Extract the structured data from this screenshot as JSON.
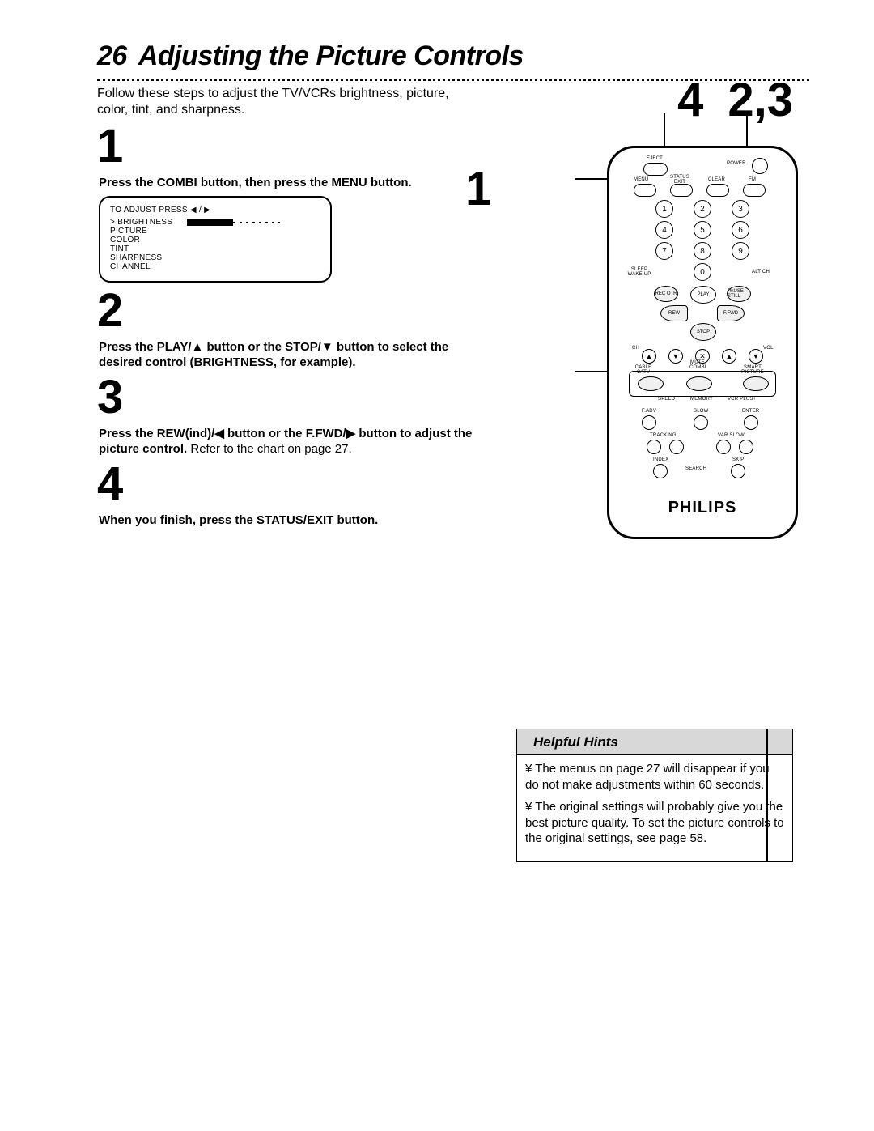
{
  "page_number": "26",
  "title": "Adjusting the Picture Controls",
  "intro": "Follow these steps to adjust the TV/VCRs brightness, picture, color, tint, and sharpness.",
  "callouts": {
    "c4": "4",
    "c23": "2,3",
    "c1": "1"
  },
  "steps": {
    "s1": {
      "num": "1",
      "text": "Press the COMBI button, then press the MENU button."
    },
    "s2": {
      "num": "2",
      "text": "Press the PLAY/▲ button or the STOP/▼ button to select the desired control (BRIGHTNESS, for example)."
    },
    "s3": {
      "num": "3",
      "text_a": "Press the REW(ind)/◀ button or the F.FWD/▶ button to adjust the picture control.",
      "text_b": "Refer to the chart on page 27."
    },
    "s4": {
      "num": "4",
      "text": "When you finish, press the STATUS/EXIT button."
    }
  },
  "osd": {
    "title": "TO ADJUST PRESS  ◀ / ▶",
    "items": [
      "> BRIGHTNESS",
      "  PICTURE",
      "  COLOR",
      "  TINT",
      "  SHARPNESS",
      "  CHANNEL"
    ]
  },
  "remote": {
    "top_row": [
      "EJECT",
      "POWER"
    ],
    "row2": [
      "MENU",
      "STATUS EXIT",
      "CLEAR",
      "FM"
    ],
    "numbers": [
      "1",
      "2",
      "3",
      "4",
      "5",
      "6",
      "7",
      "8",
      "9",
      "0"
    ],
    "side_labels": {
      "left": "SLEEP WAKE UP",
      "right": "ALT CH"
    },
    "transport": {
      "rec": "REC OTR",
      "play": "PLAY",
      "pause": "PAUSE STILL",
      "rew": "REW",
      "ffwd": "F.FWD",
      "stop": "STOP"
    },
    "arrows": {
      "ch": "CH",
      "mute": "MUTE",
      "vol": "VOL"
    },
    "mid": [
      "CABLE CATV",
      "COMBI",
      "SMART PICTURE"
    ],
    "mid_sub": [
      "SPEED",
      "MEMORY",
      "VCR PLUS+"
    ],
    "lower": [
      "F.ADV",
      "SLOW",
      "ENTER"
    ],
    "tracking": [
      "TRACKING",
      "VAR.SLOW"
    ],
    "bottom": [
      "INDEX",
      "SEARCH",
      "SKIP"
    ],
    "brand": "PHILIPS"
  },
  "hints": {
    "title": "Helpful Hints",
    "items": [
      "¥  The menus on page 27 will disappear if you do not make adjustments within 60 seconds.",
      "¥  The original settings will probably give you the best picture quality. To set the picture controls to the original settings, see page 58."
    ]
  }
}
